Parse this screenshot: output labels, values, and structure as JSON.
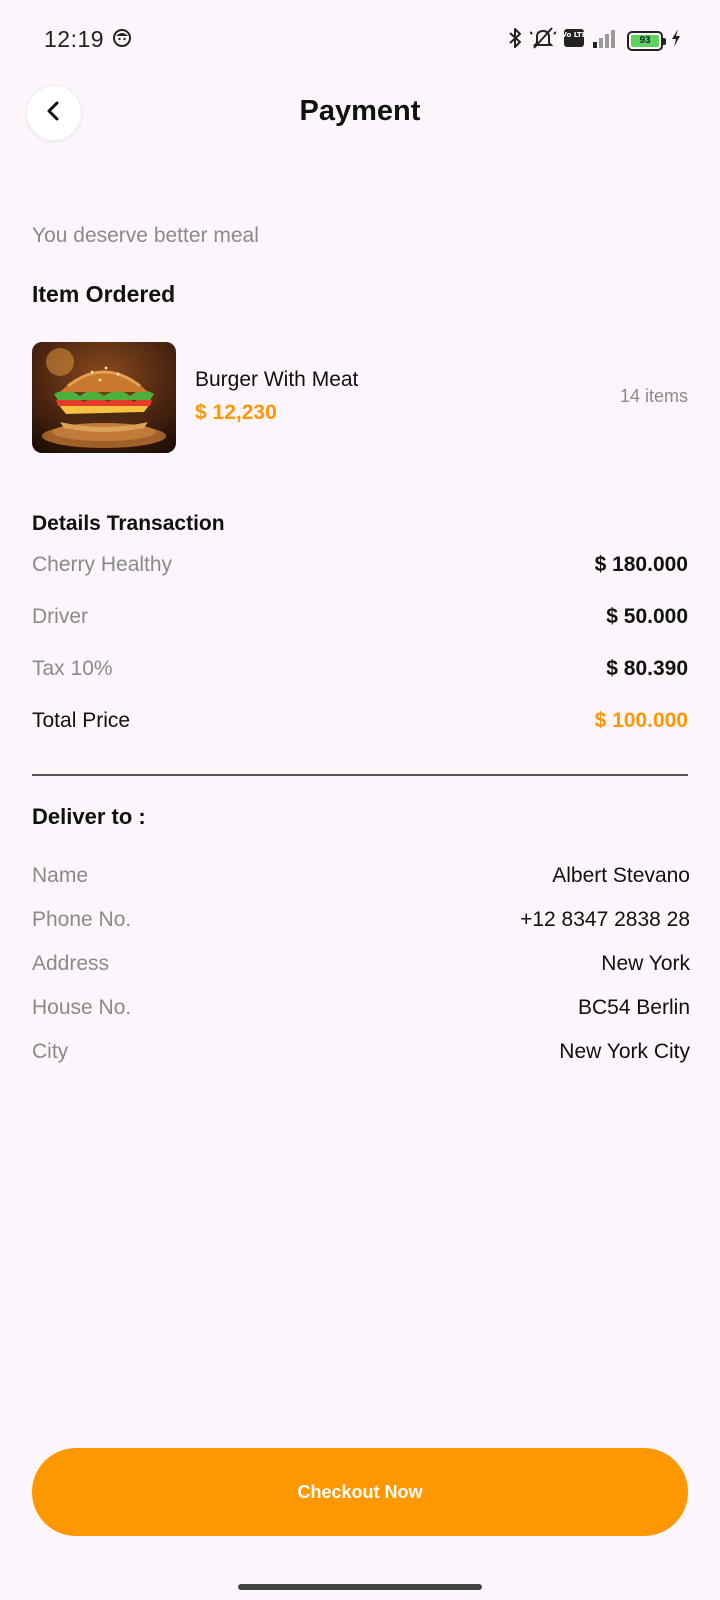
{
  "status_bar": {
    "time": "12:19",
    "battery_level": "93",
    "volte_label": "Vo LTE",
    "icons": [
      "face-icon",
      "bluetooth-icon",
      "mute-icon",
      "volte-icon",
      "signal-icon",
      "battery-icon",
      "charging-icon"
    ]
  },
  "header": {
    "title": "Payment",
    "back_icon": "chevron-left-icon"
  },
  "subtitle": "You deserve better meal",
  "order": {
    "section_title": "Item Ordered",
    "item": {
      "name": "Burger With Meat",
      "price": "$ 12,230",
      "quantity": "14 items",
      "image": "burger-photo"
    }
  },
  "transaction": {
    "section_title": "Details Transaction",
    "rows": [
      {
        "label": "Cherry Healthy",
        "value": "$ 180.000"
      },
      {
        "label": "Driver",
        "value": "$ 50.000"
      },
      {
        "label": "Tax 10%",
        "value": "$ 80.390"
      }
    ],
    "total": {
      "label": "Total Price",
      "value": "$ 100.000"
    }
  },
  "delivery": {
    "section_title": "Deliver to :",
    "rows": [
      {
        "label": "Name",
        "value": "Albert Stevano"
      },
      {
        "label": "Phone No.",
        "value": "+12 8347 2838 28"
      },
      {
        "label": "Address",
        "value": "New York"
      },
      {
        "label": "House No.",
        "value": "BC54 Berlin"
      },
      {
        "label": "City",
        "value": "New York City"
      }
    ]
  },
  "checkout_button": {
    "label": "Checkout Now"
  },
  "colors": {
    "accent": "#ff9800",
    "background": "#fcf5fc",
    "muted_text": "#8a8a8a"
  }
}
